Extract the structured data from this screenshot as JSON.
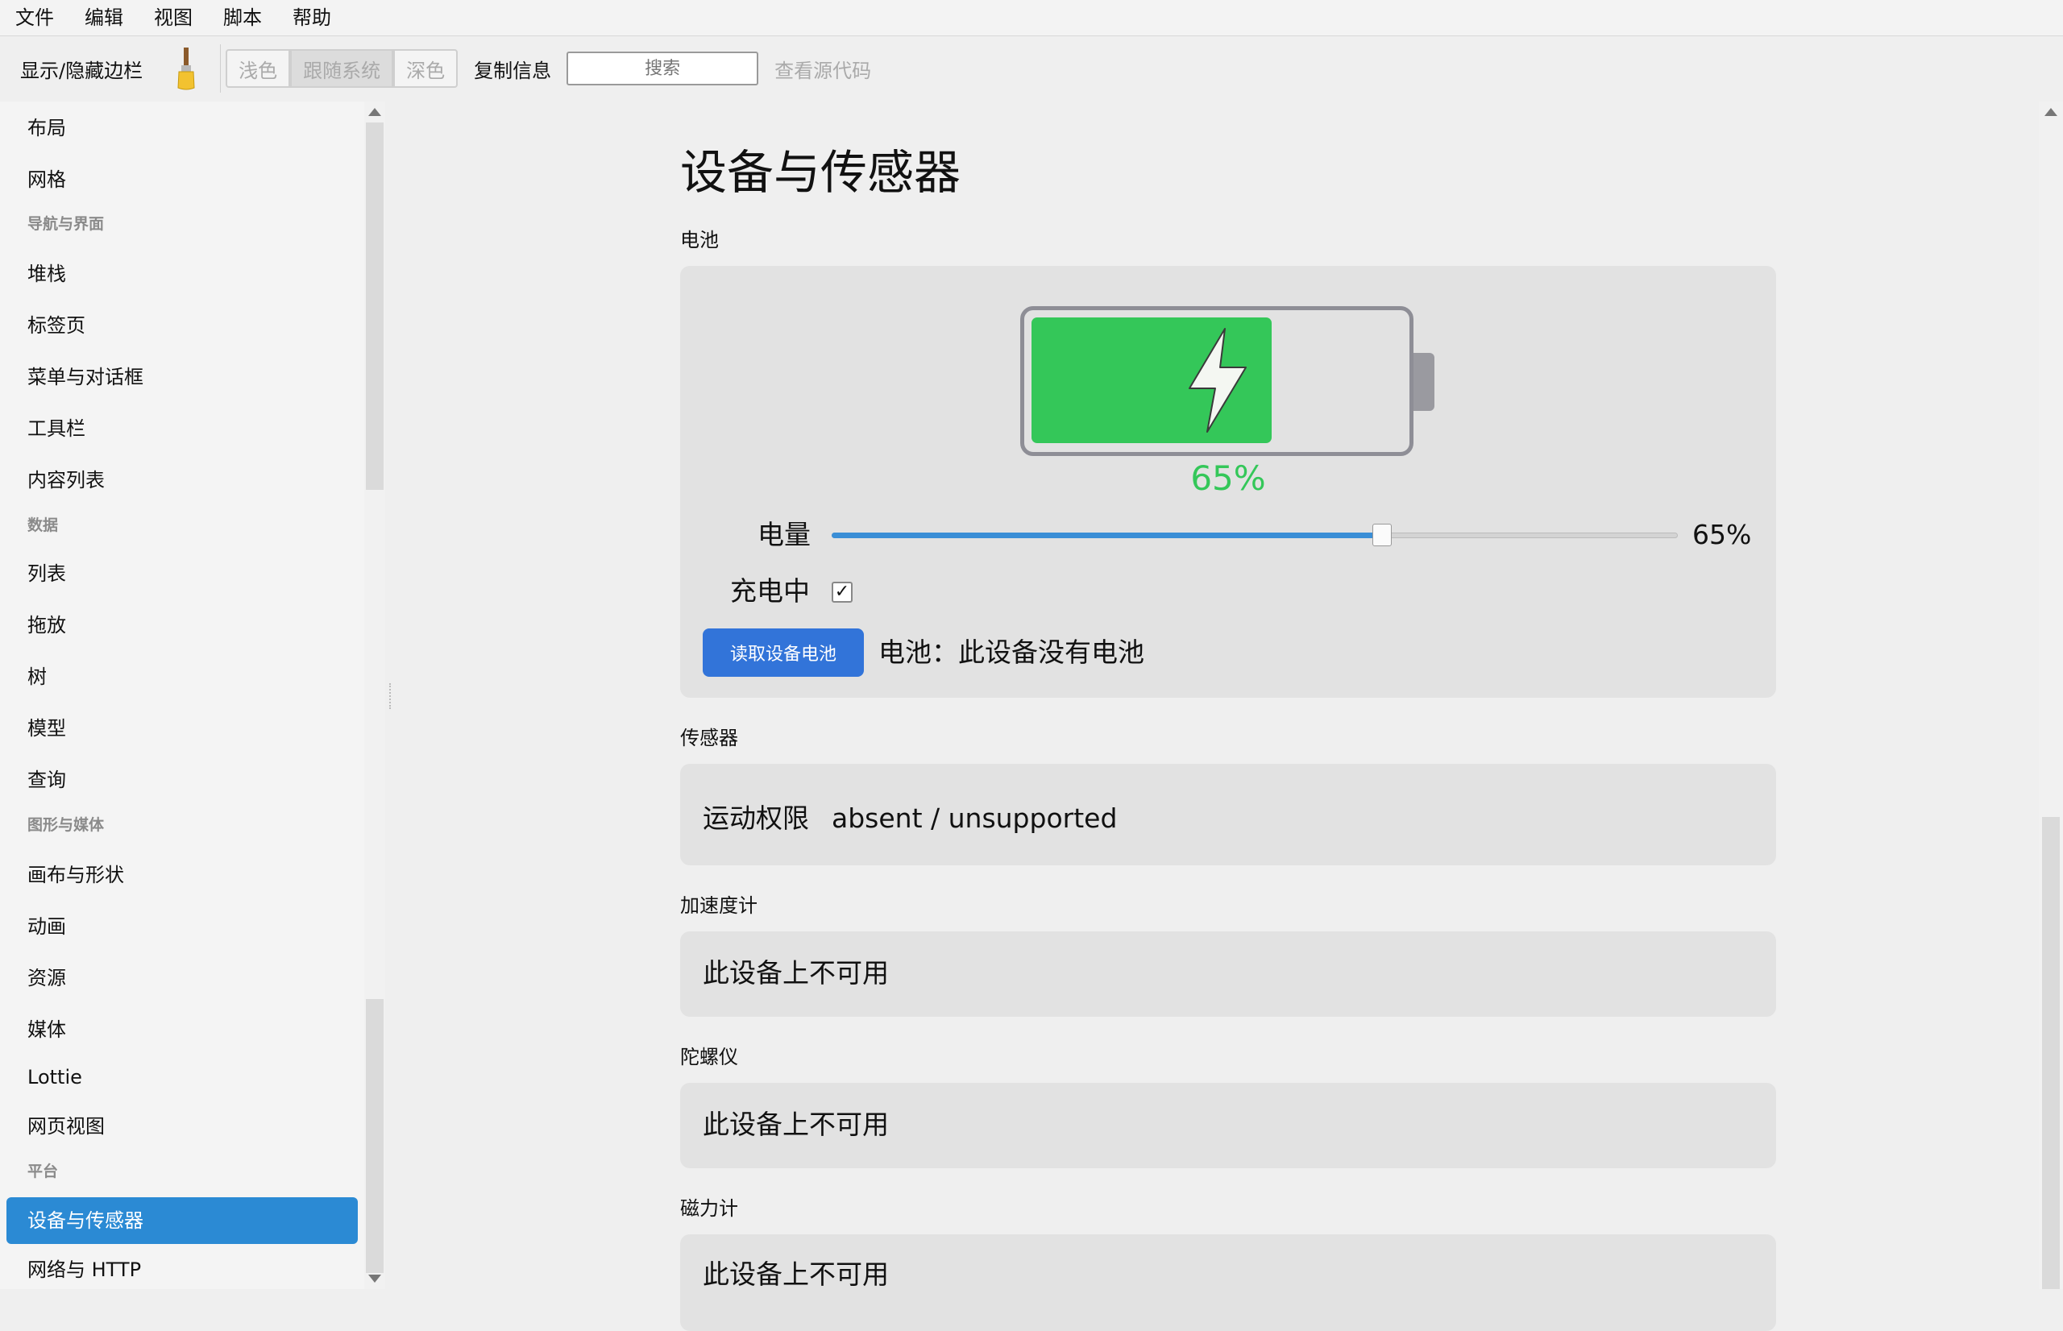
{
  "menu": [
    "文件",
    "编辑",
    "视图",
    "脚本",
    "帮助"
  ],
  "toolbar": {
    "toggle_sidebar": "显示/隐藏边栏",
    "brush_icon": "paintbrush-icon",
    "theme_light": "浅色",
    "theme_system": "跟随系统",
    "theme_dark": "深色",
    "copy_info": "复制信息",
    "search_placeholder": "搜索",
    "view_source": "查看源代码"
  },
  "sidebar": {
    "items": [
      {
        "type": "item",
        "label": "布局"
      },
      {
        "type": "item",
        "label": "网格"
      },
      {
        "type": "section",
        "label": "导航与界面"
      },
      {
        "type": "item",
        "label": "堆栈"
      },
      {
        "type": "item",
        "label": "标签页"
      },
      {
        "type": "item",
        "label": "菜单与对话框"
      },
      {
        "type": "item",
        "label": "工具栏"
      },
      {
        "type": "item",
        "label": "内容列表"
      },
      {
        "type": "section",
        "label": "数据"
      },
      {
        "type": "item",
        "label": "列表"
      },
      {
        "type": "item",
        "label": "拖放"
      },
      {
        "type": "item",
        "label": "树"
      },
      {
        "type": "item",
        "label": "模型"
      },
      {
        "type": "item",
        "label": "查询"
      },
      {
        "type": "section",
        "label": "图形与媒体"
      },
      {
        "type": "item",
        "label": "画布与形状"
      },
      {
        "type": "item",
        "label": "动画"
      },
      {
        "type": "item",
        "label": "资源"
      },
      {
        "type": "item",
        "label": "媒体"
      },
      {
        "type": "item",
        "label": "Lottie"
      },
      {
        "type": "item",
        "label": "网页视图"
      },
      {
        "type": "section",
        "label": "平台"
      },
      {
        "type": "item",
        "label": "设备与传感器",
        "selected": true
      },
      {
        "type": "item",
        "label": "网络与 HTTP"
      }
    ]
  },
  "main": {
    "title": "设备与传感器",
    "battery": {
      "section_label": "电池",
      "percent_text": "65%",
      "level_fraction": 0.65,
      "level_label": "电量",
      "level_value": "65%",
      "charging_label": "充电中",
      "charging_checked": true,
      "charging_check_glyph": "✓",
      "read_button": "读取设备电池",
      "status": "电池：此设备没有电池",
      "fill_color": "#34c759"
    },
    "sensors": {
      "section_label": "传感器",
      "motion_permission_label": "运动权限",
      "motion_permission_value": "absent / unsupported"
    },
    "accelerometer": {
      "section_label": "加速度计",
      "value": "此设备上不可用"
    },
    "gyroscope": {
      "section_label": "陀螺仪",
      "value": "此设备上不可用"
    },
    "magnetometer": {
      "section_label": "磁力计",
      "value": "此设备上不可用"
    }
  },
  "colors": {
    "accent": "#2b8ad4",
    "button": "#3274d9",
    "battery_green": "#34c759"
  }
}
